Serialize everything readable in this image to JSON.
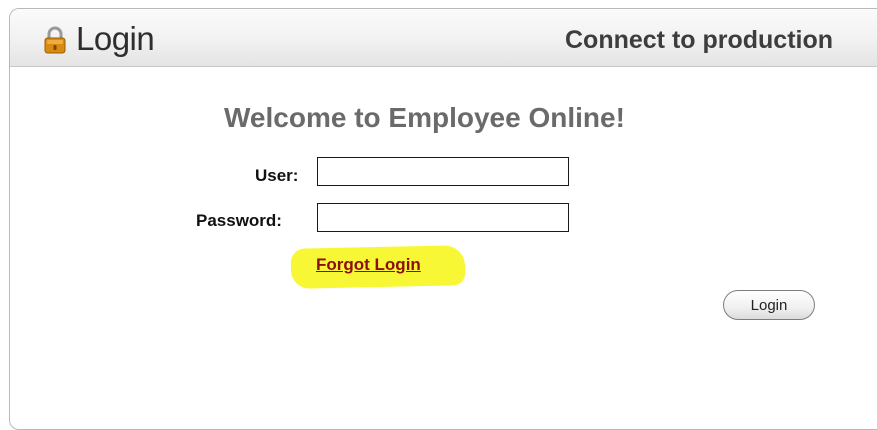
{
  "header": {
    "title": "Login",
    "connect_link": "Connect to production",
    "icon": "lock-icon"
  },
  "main": {
    "welcome": "Welcome to Employee Online!",
    "user_label": "User:",
    "user_value": "",
    "password_label": "Password:",
    "password_value": "",
    "forgot_link": "Forgot Login",
    "login_button": "Login"
  },
  "colors": {
    "highlight": "#f7f72a",
    "link": "#8b0f0f",
    "lock_body": "#d98a10"
  }
}
